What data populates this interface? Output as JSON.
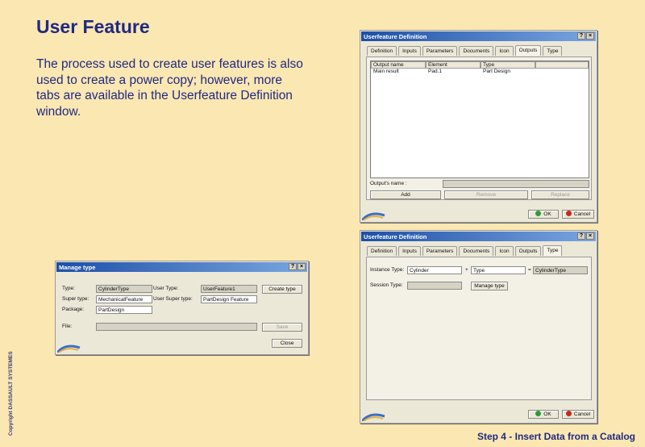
{
  "slide": {
    "title": "User Feature",
    "body": "The process used to create user features is also used to create a power copy; however, more tabs are available in the Userfeature Definition window.",
    "footer": "Step 4 - Insert Data from a Catalog",
    "copyright": "Copyright DASSAULT SYSTEMES"
  },
  "win_top": {
    "title": "Userfeature Definition",
    "help": "?",
    "close": "×",
    "tabs": [
      "Definition",
      "Inputs",
      "Parameters",
      "Documents",
      "Icon",
      "Outputs",
      "Type"
    ],
    "active_tab": "Outputs",
    "columns": [
      "Output name",
      "Element",
      "Type"
    ],
    "rows": [
      [
        "Main result",
        "Pad.1",
        "Part Design"
      ]
    ],
    "outputs_name_label": "Output's name :",
    "add": "Add",
    "remove": "Remove",
    "replace": "Replace",
    "ok": "OK",
    "cancel": "Cancel"
  },
  "win_bottom": {
    "title": "Userfeature Definition",
    "help": "?",
    "close": "×",
    "tabs": [
      "Definition",
      "Inputs",
      "Parameters",
      "Documents",
      "Icon",
      "Outputs",
      "Type"
    ],
    "active_tab": "Type",
    "instance_type_label": "Instance Type:",
    "instance_type_value": "Cylinder",
    "plus": "+",
    "type_value": "Type",
    "equals": "=",
    "result_value": "CylinderType",
    "session_type_label": "Session Type:",
    "manage_type": "Manage type",
    "ok": "OK",
    "cancel": "Cancel"
  },
  "win_manage": {
    "title": "Manage type",
    "help": "?",
    "close": "×",
    "type_label": "Type:",
    "type_value": "CylinderType",
    "user_type_label": "User Type:",
    "user_type_value": "UserFeature1",
    "create_type": "Create type",
    "super_type_label": "Super type:",
    "super_type_value": "MechanicalFeature",
    "user_super_type_label": "User Super type:",
    "user_super_type_value": "PartDesign Feature",
    "package_label": "Package:",
    "package_value": "PartDesign",
    "file_label": "File:",
    "save": "Save",
    "close_btn": "Close"
  },
  "colors": {
    "background": "#fbe7b2",
    "title_text": "#1f2a80",
    "titlebar": "#1e4fa8",
    "ok_green": "#2e9a3a",
    "cancel_red": "#c8281e"
  }
}
